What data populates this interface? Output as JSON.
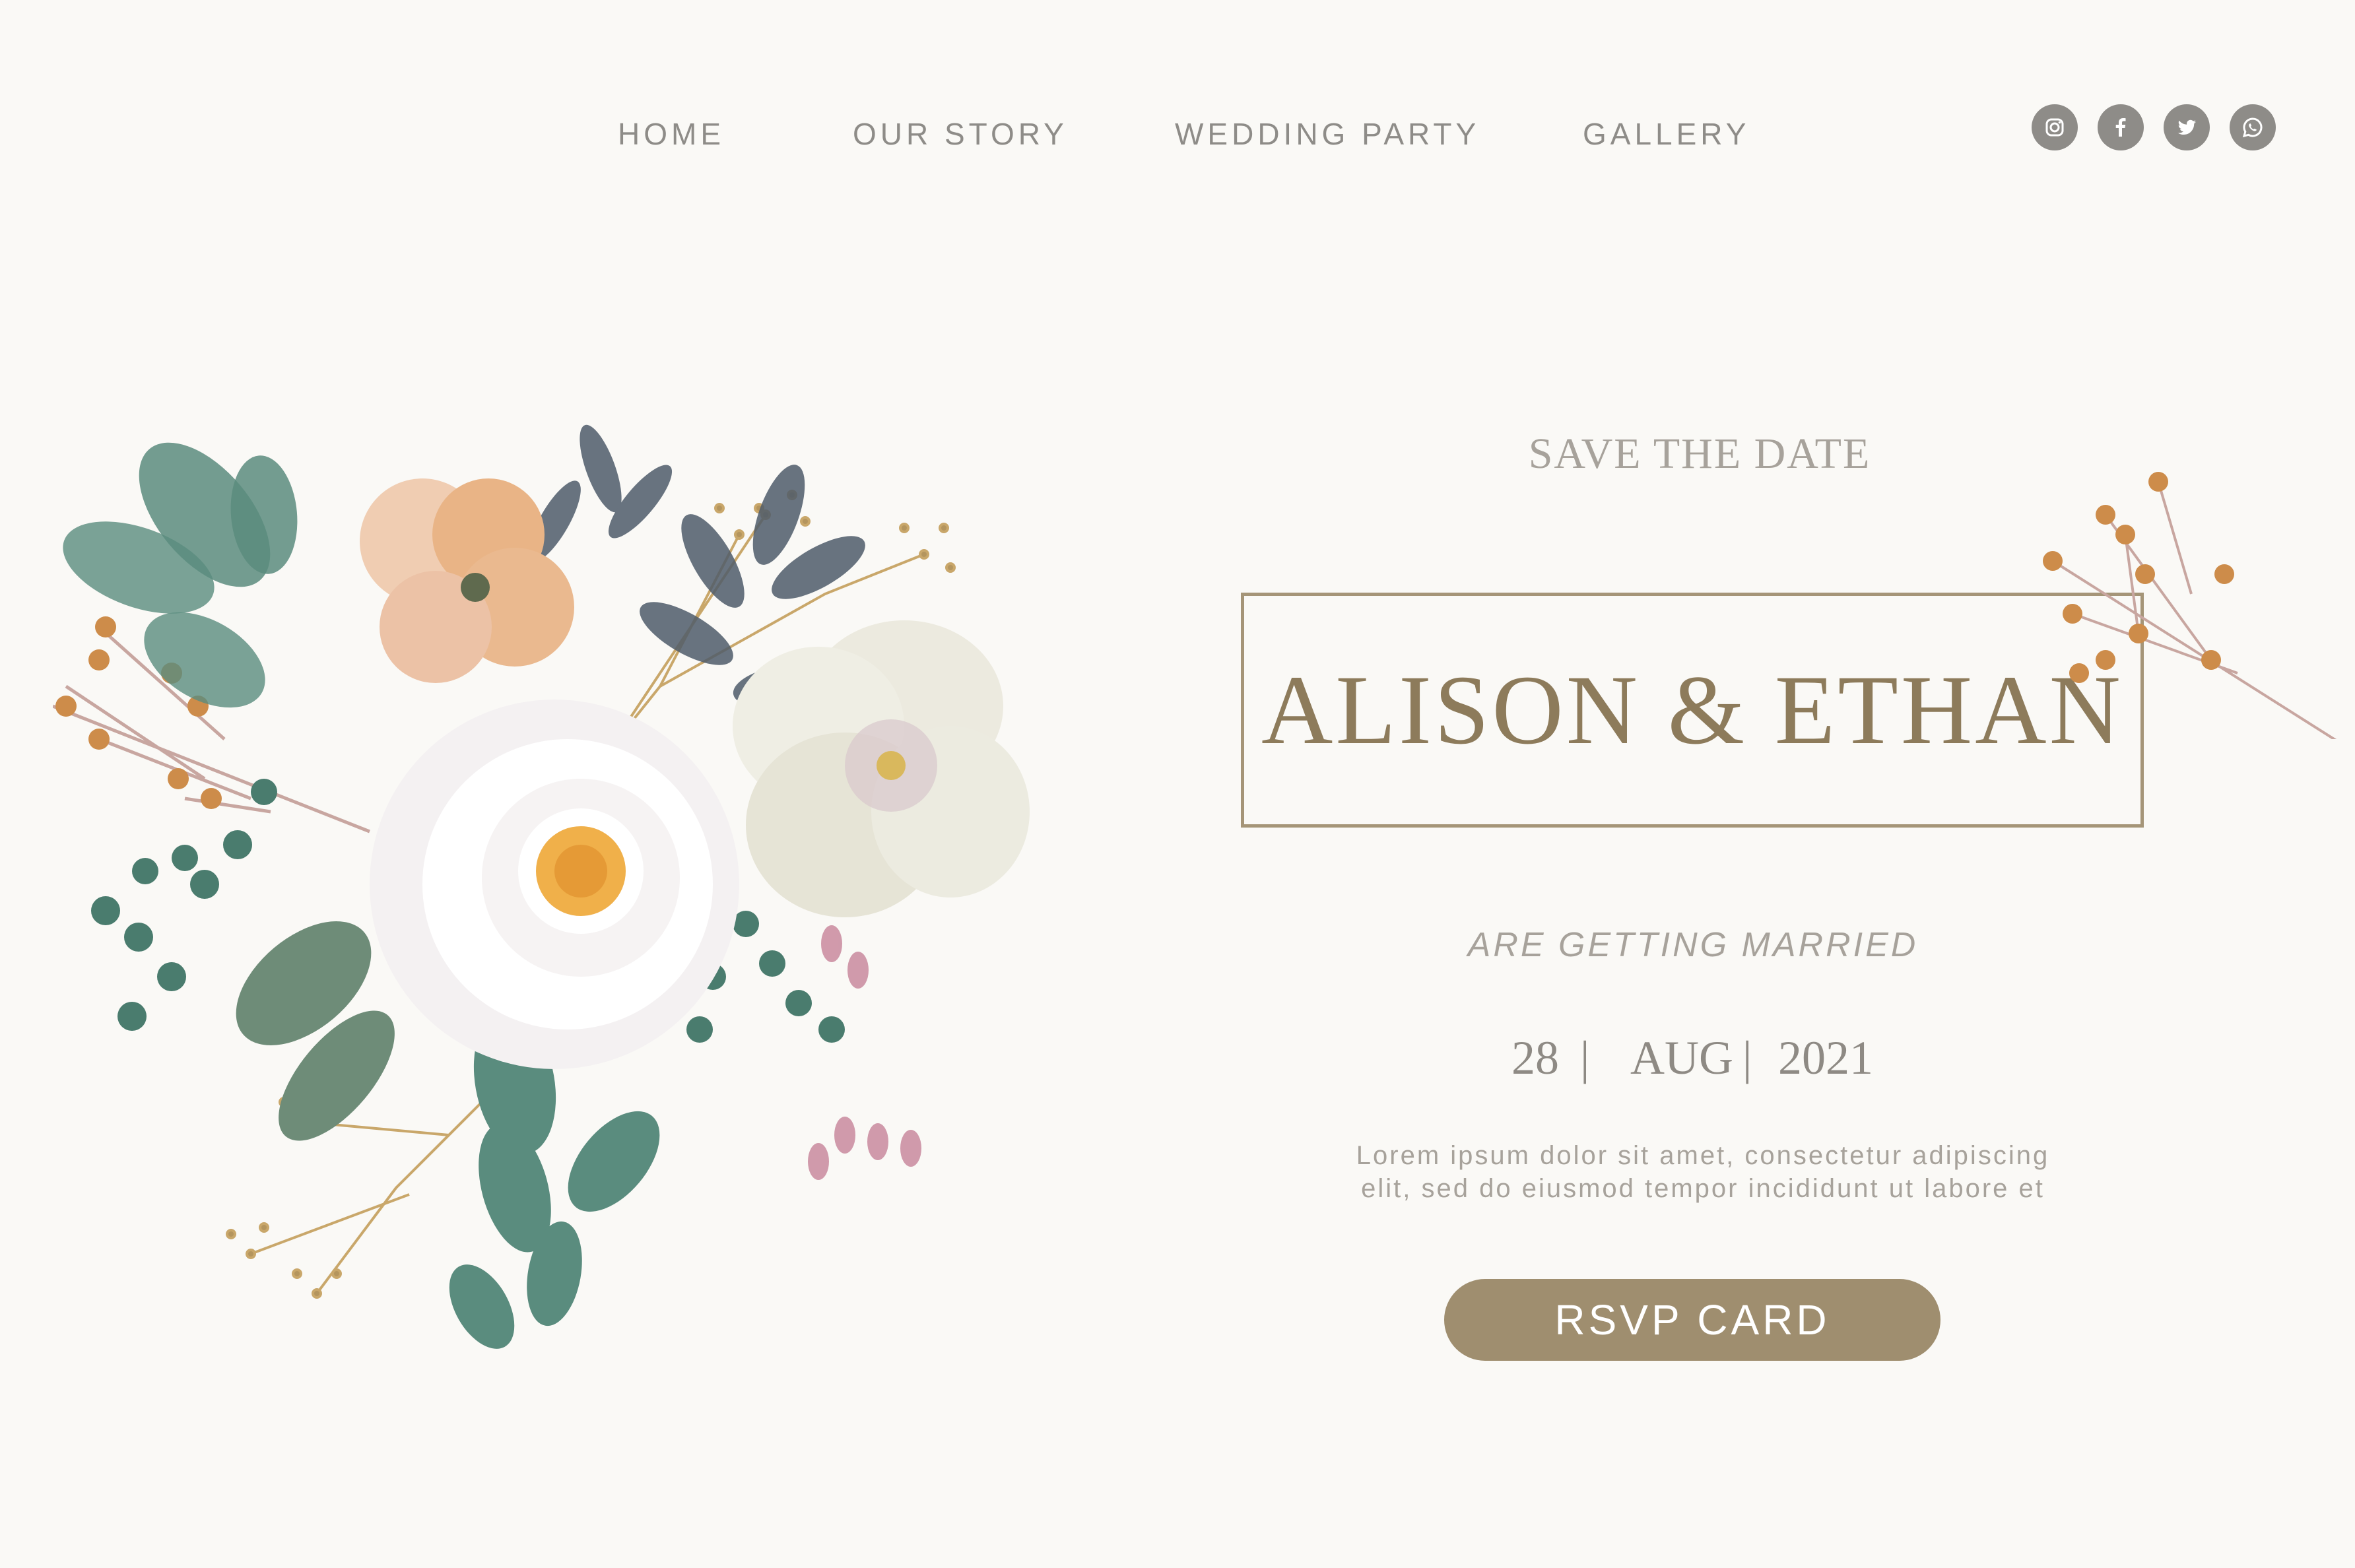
{
  "nav": {
    "items": [
      {
        "label": "HOME"
      },
      {
        "label": "OUR STORY"
      },
      {
        "label": "WEDDING PARTY"
      },
      {
        "label": "GALLERY"
      }
    ]
  },
  "social": {
    "icons": [
      "instagram-icon",
      "facebook-icon",
      "twitter-icon",
      "whatsapp-icon"
    ],
    "color": "#8e8c88"
  },
  "hero": {
    "kicker": "SAVE THE DATE",
    "names": "ALISON & ETHAN",
    "subtitle": "ARE GETTING MARRIED",
    "date": {
      "day": "28",
      "month": "AUG",
      "year": "2021",
      "separator": "|"
    },
    "body_lines": [
      "Lorem ipsum dolor sit amet, consectetur adipiscing",
      "elit, sed do eiusmod tempor incididunt ut labore et"
    ],
    "cta_label": "RSVP CARD"
  },
  "colors": {
    "background": "#faf9f6",
    "accent_gold": "#9f8e6f",
    "muted_text": "#a7a29b"
  }
}
